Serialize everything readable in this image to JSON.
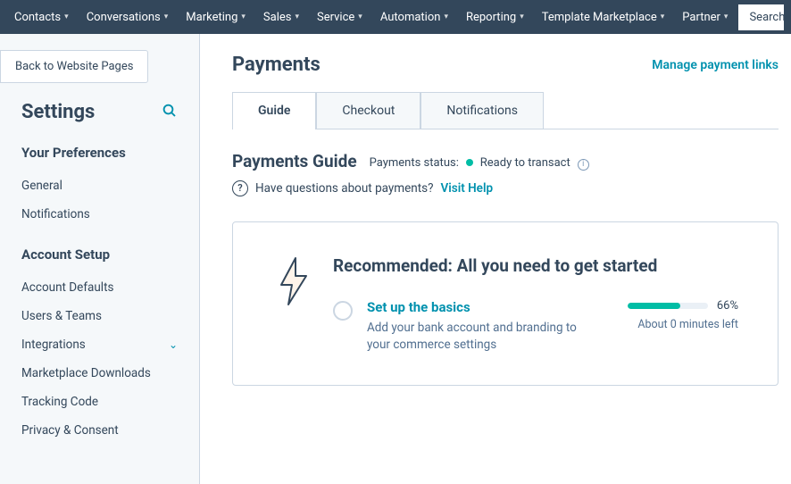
{
  "nav": {
    "items": [
      "Contacts",
      "Conversations",
      "Marketing",
      "Sales",
      "Service",
      "Automation",
      "Reporting",
      "Template Marketplace",
      "Partner"
    ],
    "search_placeholder": "Search"
  },
  "sidebar": {
    "back_label": "Back to Website Pages",
    "title": "Settings",
    "sections": [
      {
        "title": "Your Preferences",
        "items": [
          {
            "label": "General"
          },
          {
            "label": "Notifications"
          }
        ]
      },
      {
        "title": "Account Setup",
        "items": [
          {
            "label": "Account Defaults"
          },
          {
            "label": "Users & Teams"
          },
          {
            "label": "Integrations",
            "expandable": true
          },
          {
            "label": "Marketplace Downloads"
          },
          {
            "label": "Tracking Code"
          },
          {
            "label": "Privacy & Consent"
          }
        ]
      }
    ]
  },
  "page": {
    "title": "Payments",
    "manage_link": "Manage payment links",
    "tabs": [
      "Guide",
      "Checkout",
      "Notifications"
    ],
    "active_tab": 0,
    "sub_title": "Payments Guide",
    "status_label": "Payments status:",
    "status_value": "Ready to transact",
    "help_question": "Have questions about payments?",
    "help_link": "Visit Help",
    "card": {
      "title": "Recommended: All you need to get started",
      "step_title": "Set up the basics",
      "step_desc": "Add your bank account and branding to your commerce settings",
      "progress_pct": 66,
      "progress_label": "66%",
      "time_left": "About 0 minutes left"
    }
  }
}
